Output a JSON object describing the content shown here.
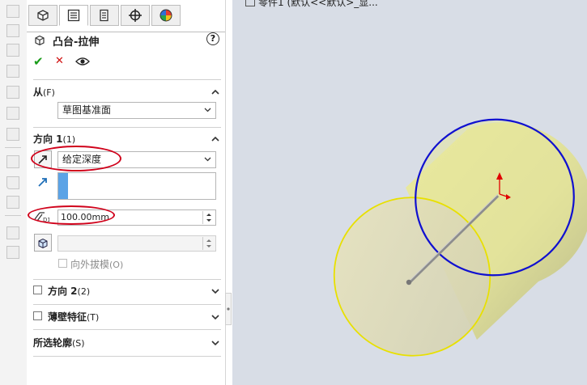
{
  "tabs": [
    {
      "name": "feature-manager-tab-icon"
    },
    {
      "name": "property-manager-tab-icon"
    },
    {
      "name": "configuration-manager-tab-icon"
    },
    {
      "name": "dimxpert-manager-tab-icon"
    },
    {
      "name": "display-manager-tab-icon"
    }
  ],
  "feature": {
    "title": "凸台-拉伸",
    "help": "?",
    "ok_glyph": "✔",
    "cancel_glyph": "✕"
  },
  "from": {
    "label": "从",
    "shortcut": "(F)",
    "value": "草图基准面"
  },
  "direction1": {
    "label": "方向 1",
    "shortcut": "(1)",
    "end_condition": "给定深度",
    "depth": "100.00mm",
    "draft_outward": "向外拔模",
    "draft_shortcut": "(O)"
  },
  "direction2": {
    "label": "方向 2",
    "shortcut": "(2)"
  },
  "thin_feature": {
    "label": "薄壁特征",
    "shortcut": "(T)"
  },
  "selected_contours": {
    "label": "所选轮廓",
    "shortcut": "(S)"
  },
  "viewport": {
    "breadcrumb": "零件1 (默认<<默认>_显..."
  },
  "colors": {
    "highlight_ellipse": "#d0021b",
    "cylinder_fill": "#e4e39a",
    "front_edge": "#e8e000",
    "back_edge": "#1010d0",
    "axis_red": "#e00000",
    "depth_bar": "#5ba3e6",
    "ok_green": "#1a9c1a",
    "cancel_red": "#d01010"
  }
}
